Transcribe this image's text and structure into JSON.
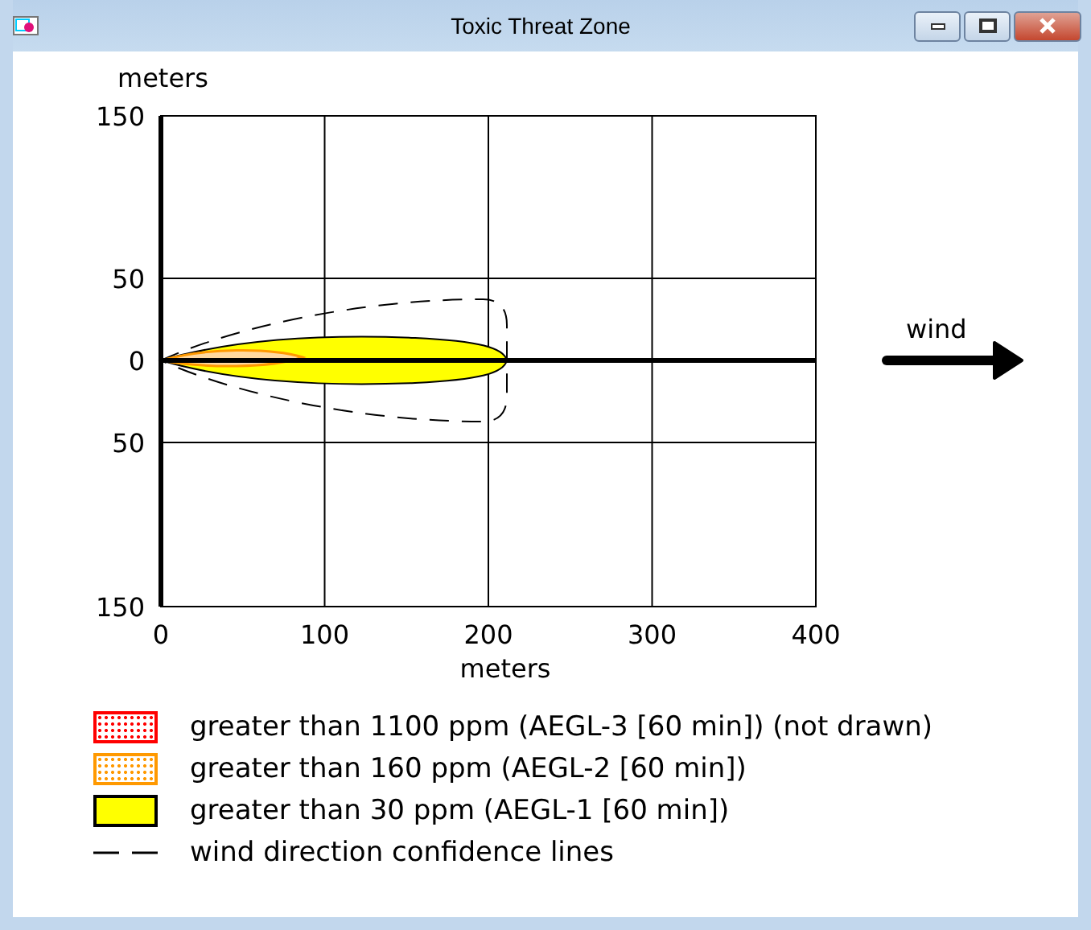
{
  "window": {
    "title": "Toxic Threat Zone"
  },
  "plot": {
    "y_axis_label": "meters",
    "y_ticks": [
      "150",
      "50",
      "0",
      "50",
      "150"
    ],
    "x_ticks": [
      "0",
      "100",
      "200",
      "300",
      "400"
    ],
    "x_axis_label": "meters",
    "wind_label": "wind"
  },
  "legend": [
    {
      "kind": "dotted-swatch",
      "color": "#ff0000",
      "label": "greater than 1100 ppm (AEGL-3 [60 min]) (not drawn)"
    },
    {
      "kind": "dotted-swatch",
      "color": "#ff9900",
      "label": "greater than 160 ppm (AEGL-2 [60 min])"
    },
    {
      "kind": "solid-swatch",
      "color": "#ffff00",
      "label": "greater than 30 ppm (AEGL-1 [60 min])"
    },
    {
      "kind": "dashed-line",
      "color": "#000000",
      "label": "wind direction confidence lines"
    }
  ]
}
